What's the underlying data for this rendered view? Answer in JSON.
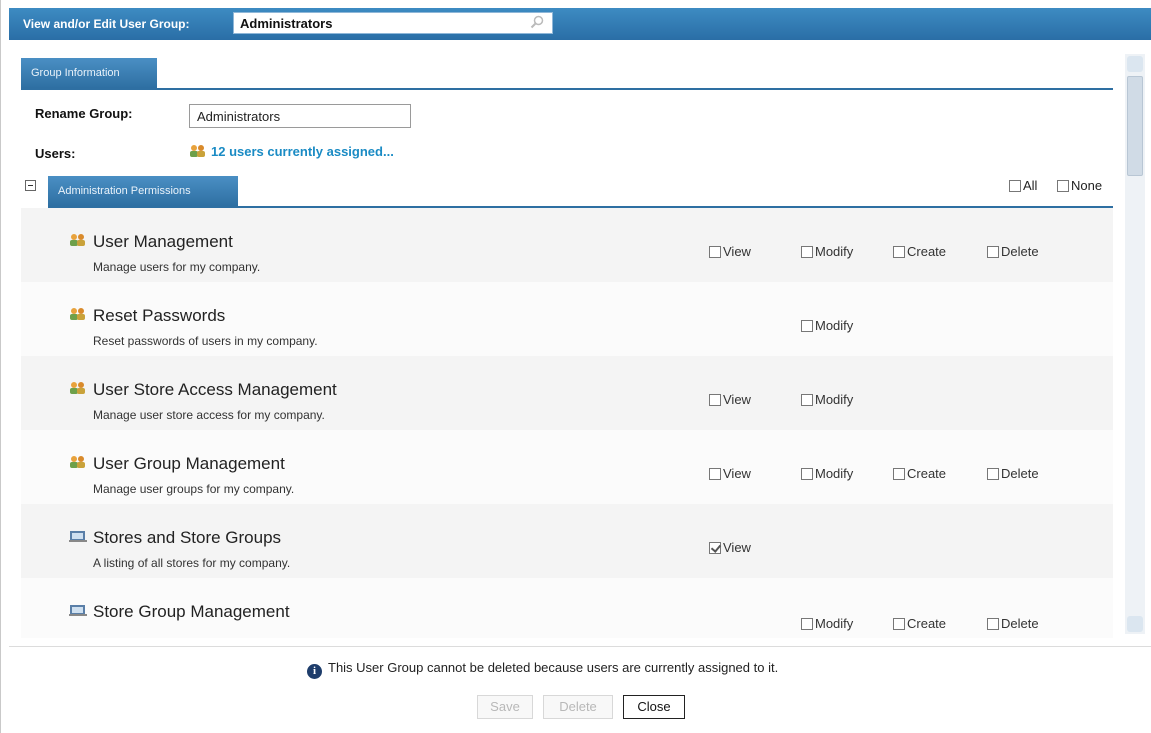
{
  "header": {
    "title": "View and/or Edit User Group:",
    "group_value": "Administrators"
  },
  "group_info": {
    "tab_label": "Group Information",
    "rename_label": "Rename Group:",
    "rename_value": "Administrators",
    "users_label": "Users:",
    "users_link": "12 users currently assigned..."
  },
  "admin_permissions": {
    "tab_label": "Administration Permissions",
    "all_label": "All",
    "none_label": "None",
    "items": [
      {
        "title": "User Management",
        "desc": "Manage users for my company.",
        "icon": "users-icon",
        "view": "View",
        "modify": "Modify",
        "create": "Create",
        "delete": "Delete",
        "view_checked": false
      },
      {
        "title": "Reset Passwords",
        "desc": "Reset passwords of users in my company.",
        "icon": "users-icon",
        "modify": "Modify"
      },
      {
        "title": "User Store Access Management",
        "desc": "Manage user store access for my company.",
        "icon": "users-icon",
        "view": "View",
        "modify": "Modify"
      },
      {
        "title": "User Group Management",
        "desc": "Manage user groups for my company.",
        "icon": "users-icon",
        "view": "View",
        "modify": "Modify",
        "create": "Create",
        "delete": "Delete"
      },
      {
        "title": "Stores and Store Groups",
        "desc": "A listing of all stores for my company.",
        "icon": "store-icon",
        "view": "View",
        "view_checked": true
      },
      {
        "title": "Store Group Management",
        "desc": "",
        "icon": "store-icon",
        "modify": "Modify",
        "create": "Create",
        "delete": "Delete"
      }
    ]
  },
  "footer": {
    "info_text": "This User Group cannot be deleted because users are currently assigned to it.",
    "save_label": "Save",
    "delete_label": "Delete",
    "close_label": "Close"
  },
  "colors": {
    "header_blue": "#2a6ea6",
    "link_blue": "#1a8bc4"
  }
}
